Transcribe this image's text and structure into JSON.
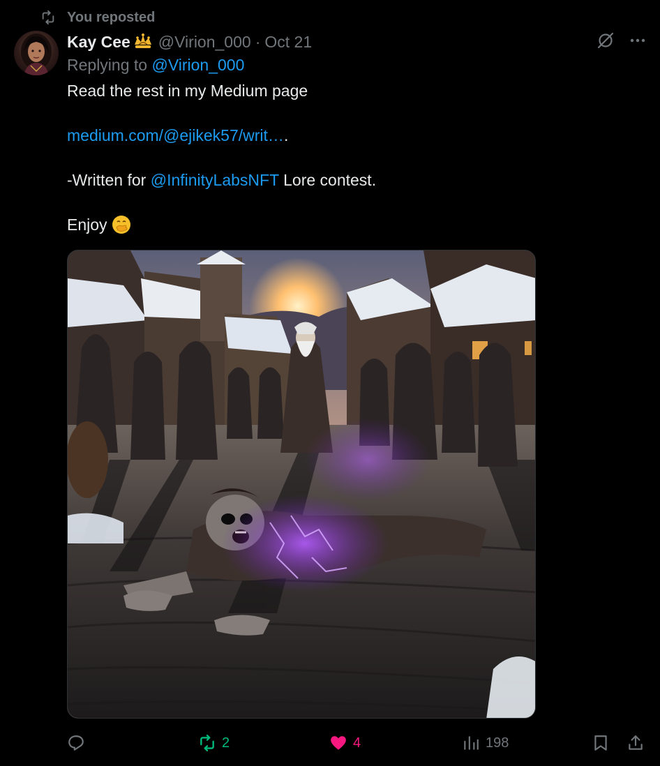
{
  "repost_banner": {
    "label": "You reposted",
    "icon": "repost-icon"
  },
  "author": {
    "display_name": "Kay Cee",
    "handle": "@Virion_000",
    "separator": "·",
    "date": "Oct 21",
    "badge_icon": "crown-badge-icon"
  },
  "reply": {
    "prefix": "Replying to",
    "mention": "@Virion_000"
  },
  "tweet": {
    "line1": "Read the rest in my Medium page",
    "link": "medium.com/@ejikek57/writ…",
    "link_suffix": ".",
    "line3_prefix": "-Written for",
    "line3_mention": "@InfinityLabsNFT",
    "line3_suffix": " Lore contest.",
    "line4": "Enjoy",
    "emoji": "face-with-hand-over-mouth-emoji"
  },
  "media": {
    "description_icon": "zombie-village-image"
  },
  "actions": {
    "reply_count": "",
    "repost_count": "2",
    "like_count": "4",
    "views_count": "198",
    "colors": {
      "repost": "#00ba7c",
      "like": "#f91880",
      "muted": "#71767b",
      "link": "#1d9bf0"
    }
  }
}
